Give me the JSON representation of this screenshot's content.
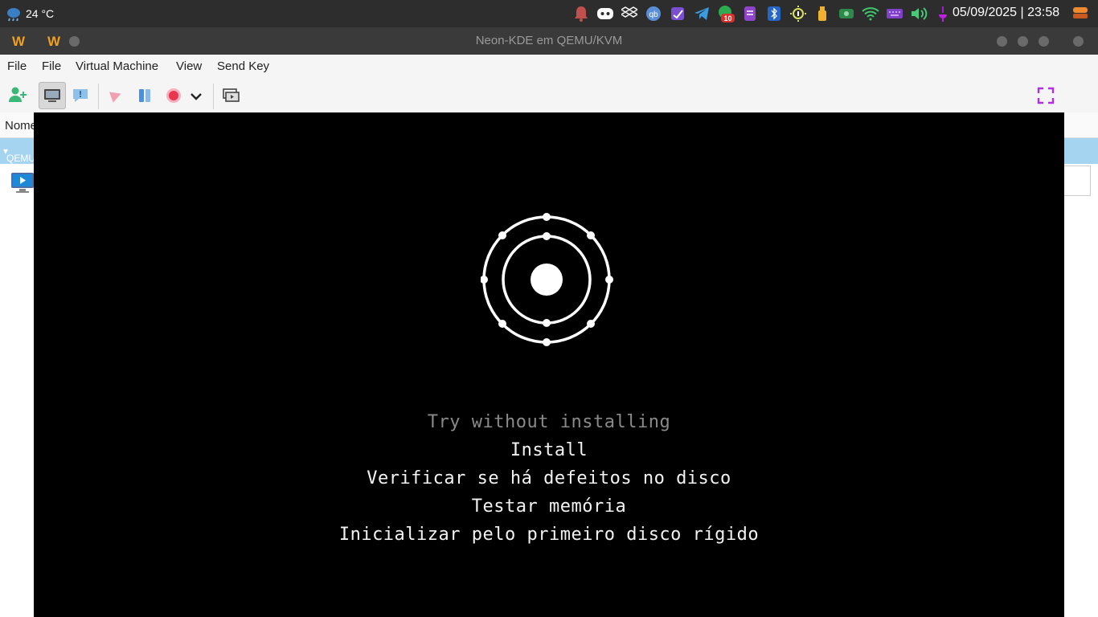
{
  "top_panel": {
    "weather": "24 °C",
    "clock": "05/09/2025 | 23:58",
    "tray_icons": [
      "notification-bell-icon",
      "discord-icon",
      "dropbox-icon",
      "qbittorrent-icon",
      "onenote-icon",
      "telegram-icon",
      "update-badge-icon",
      "tasks-icon",
      "bluetooth-icon",
      "brightness-icon",
      "usb-drive-icon",
      "vpn-icon",
      "wifi-icon",
      "keyboard-icon",
      "volume-icon",
      "clipboard-icon"
    ],
    "badge_count": "10"
  },
  "background_app": {
    "menu_file": "File",
    "column_name": "Nome",
    "group_label": "QEMU"
  },
  "vm_window": {
    "title": "Neon-KDE em QEMU/KVM",
    "menu": [
      "File",
      "Virtual Machine",
      "View",
      "Send Key"
    ],
    "toolbar": [
      "console-icon",
      "details-icon",
      "run-icon",
      "pause-icon",
      "shutdown-icon",
      "dropdown-icon",
      "snapshots-icon",
      "fullscreen-icon"
    ]
  },
  "boot_menu": {
    "items": [
      "Try without installing",
      "Install",
      "Verificar se há defeitos no disco",
      "Testar memória",
      "Inicializar pelo primeiro disco rígido"
    ],
    "selected_index": 0
  },
  "colors": {
    "accent_logo": "#f0a020",
    "selection_group": "#a5d4f1",
    "boot_text": "#f2f2f2",
    "boot_text_dim": "#8a8a8a"
  }
}
